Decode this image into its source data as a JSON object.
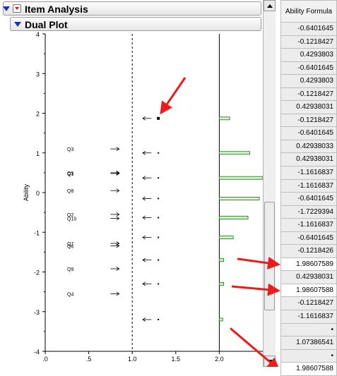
{
  "report": {
    "item_analysis_title": "Item Analysis",
    "dual_plot_title": "Dual Plot"
  },
  "chart_data": {
    "type": "scatter",
    "xlabel": "",
    "ylabel": "Ability",
    "xlim": [
      0,
      2.5
    ],
    "ylim": [
      -4,
      4
    ],
    "x_ticks": [
      0,
      0.5,
      1.0,
      1.5,
      2.0
    ],
    "x_tick_labels": [
      ".0",
      ".5",
      "1.0",
      "1.5",
      "2.0"
    ],
    "y_ticks": [
      -4,
      -3,
      -2,
      -1,
      0,
      1,
      2,
      3,
      4
    ],
    "y_tick_labels": [
      "-4",
      "-3",
      "-2",
      "-1",
      "0",
      "1",
      "2",
      "3",
      "4"
    ],
    "items": [
      {
        "label": "Q3",
        "y": 1.1
      },
      {
        "label": "Q5",
        "y": 0.5
      },
      {
        "label": "Q1",
        "y": 0.48
      },
      {
        "label": "Q8",
        "y": 0.05
      },
      {
        "label": "Q2",
        "y": -0.55
      },
      {
        "label": "Q10",
        "y": -0.65
      },
      {
        "label": "Q7",
        "y": -1.28
      },
      {
        "label": "Q6",
        "y": -1.34
      },
      {
        "label": "Q9",
        "y": -1.92
      },
      {
        "label": "Q4",
        "y": -2.55
      }
    ],
    "item_arrows_x": [
      0.75,
      0.85
    ],
    "ability_levels": [
      1.87,
      1.0,
      0.37,
      -0.15,
      -0.63,
      -1.13,
      -1.7,
      -2.3,
      -3.2
    ],
    "ability_arrows_x": [
      1.12,
      1.22
    ],
    "ability_marks_x": 1.3,
    "highlighted_level": 1.87,
    "histogram": {
      "base_x": 2.0,
      "bins": [
        {
          "y": 1.87,
          "width": 0.12
        },
        {
          "y": 1.0,
          "width": 0.35
        },
        {
          "y": 0.37,
          "width": 0.5
        },
        {
          "y": -0.15,
          "width": 0.46
        },
        {
          "y": -0.63,
          "width": 0.33
        },
        {
          "y": -1.13,
          "width": 0.16
        },
        {
          "y": -1.7,
          "width": 0.05
        },
        {
          "y": -2.3,
          "width": 0.05
        },
        {
          "y": -3.2,
          "width": 0.04
        }
      ]
    },
    "reference_lines_x": [
      1.0,
      2.0
    ],
    "annotation_arrow_color": "#ee1b1b",
    "bar_fill": "#d6f2c8",
    "bar_stroke": "#1e6a1e"
  },
  "table": {
    "column_header": "Ability Formula",
    "cells": [
      "-0.6401645",
      "-0.1218427",
      "0.4293803",
      "-0.6401645",
      "0.4293803",
      "-0.1218427",
      "0.42938031",
      "-0.1218427",
      "-0.6401645",
      "0.42938033",
      "0.42938031",
      "-1.1616837",
      "-1.1616837",
      "-0.6401645",
      "-1.7229394",
      "-1.1616837",
      "-0.6401645",
      "-0.1218426",
      "1.98607589",
      "0.42938031",
      "1.98607588",
      "-0.1218427",
      "-1.1616837",
      "•",
      "1.07386541",
      "•",
      "1.98607588"
    ],
    "highlighted_rows": [
      18,
      20,
      26
    ]
  }
}
